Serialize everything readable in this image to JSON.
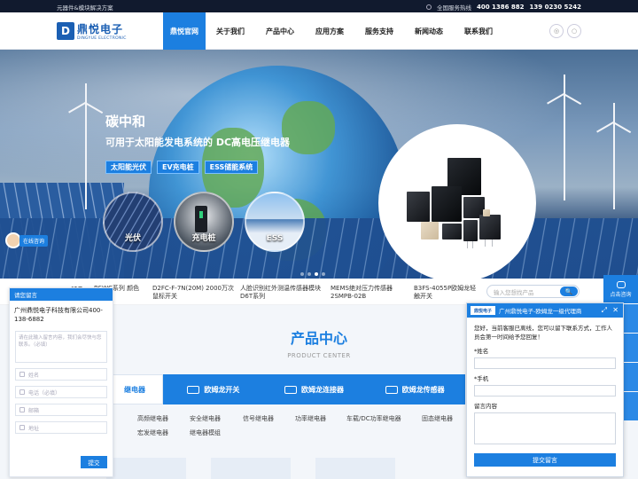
{
  "topbar": {
    "slogan": "元器件&模块解决方案",
    "hotline_label": "全国服务热线",
    "phone1": "400 1386 882",
    "phone2": "139 0230 5242"
  },
  "logo": {
    "cn": "鼎悦电子",
    "en": "DINGYUE ELECTRONIC",
    "mark": "D"
  },
  "nav": {
    "items": [
      "鼎悦官网",
      "关于我们",
      "产品中心",
      "应用方案",
      "服务支持",
      "新闻动态",
      "联系我们"
    ]
  },
  "hero": {
    "title": "碳中和",
    "subtitle": "可用于太阳能发电系统的 DC高电压继电器",
    "tags": [
      "太阳能光伏",
      "EV充电桩",
      "ESS储能系统"
    ],
    "bubbles": [
      "光伏",
      "充电桩",
      "ESS"
    ]
  },
  "chat_mini": {
    "text": "在线咨询"
  },
  "news": {
    "label": "新品",
    "items": [
      "BSWC系列 颜色",
      "D2FC-F-7N(20M) 2000万次鼠标开关",
      "人脸识别红外测温传感器模块D6T系列",
      "MEMS绝对压力传感器 2SMPB-02B",
      "B3FS-4055P欧姆龙轻触开关"
    ],
    "search_placeholder": "输入您想找产品",
    "search_button": "🔍"
  },
  "products": {
    "title": "产品中心",
    "title_en": "PRODUCT CENTER",
    "tabs": [
      "欧姆龙继电器",
      "欧姆龙开关",
      "欧姆龙连接器",
      "欧姆龙传感器"
    ],
    "first_tab_visible": "继电器",
    "subcats": [
      "高频继电器",
      "安全继电器",
      "信号继电器",
      "功率继电器",
      "车载/DC功率继电器",
      "固态继电器",
      "宏发继电器",
      "继电器模组"
    ]
  },
  "left_form": {
    "header": "请您留言",
    "company": "广州鼎悦电子科技有限公司400-138-6882",
    "textarea_placeholder": "请在此输入留言内容，我们会尽快与您联系。（必填）",
    "fields": [
      "姓名",
      "电话（必填）",
      "邮箱",
      "地址"
    ],
    "submit": "提交"
  },
  "right_side": {
    "top": "点击咨询",
    "items": [
      "询",
      "询",
      "询",
      "询"
    ]
  },
  "right_form": {
    "logo": "鼎悦电子",
    "title": "广州鼎悦电子-欧姆龙一级代理商",
    "message": "您好，当前客服已离线，您可以留下联系方式，工作人员会第一时间给予您回复！",
    "field_name": "*姓名",
    "field_phone": "*手机",
    "field_content": "留言内容",
    "submit": "提交留言"
  }
}
